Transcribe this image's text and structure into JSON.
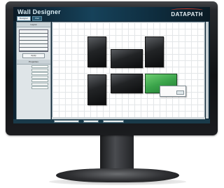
{
  "app": {
    "title": "Wall Designer",
    "brand": "DATAPATH",
    "tabs": [
      "Designer",
      "Wall"
    ]
  },
  "left_panel": {
    "header": "Layout",
    "button_label": "Apply",
    "properties_header": "Properties",
    "properties": [
      {
        "label": "",
        "value": ""
      },
      {
        "label": "",
        "value": ""
      },
      {
        "label": "",
        "value": ""
      },
      {
        "label": "",
        "value": ""
      },
      {
        "label": "",
        "value": ""
      },
      {
        "label": "",
        "value": ""
      },
      {
        "label": "",
        "value": ""
      }
    ]
  },
  "canvas": {
    "displays": [
      {
        "id": "display-1",
        "selected": false
      },
      {
        "id": "display-2",
        "selected": false
      },
      {
        "id": "display-3",
        "selected": false
      },
      {
        "id": "display-4",
        "selected": false
      },
      {
        "id": "display-5",
        "selected": false
      },
      {
        "id": "display-6",
        "selected": true
      }
    ],
    "tooltip_text": ""
  },
  "colors": {
    "selected_display": "#3aa34a",
    "titlebar": "#16425a",
    "brand_accent": "#d23a2a"
  }
}
